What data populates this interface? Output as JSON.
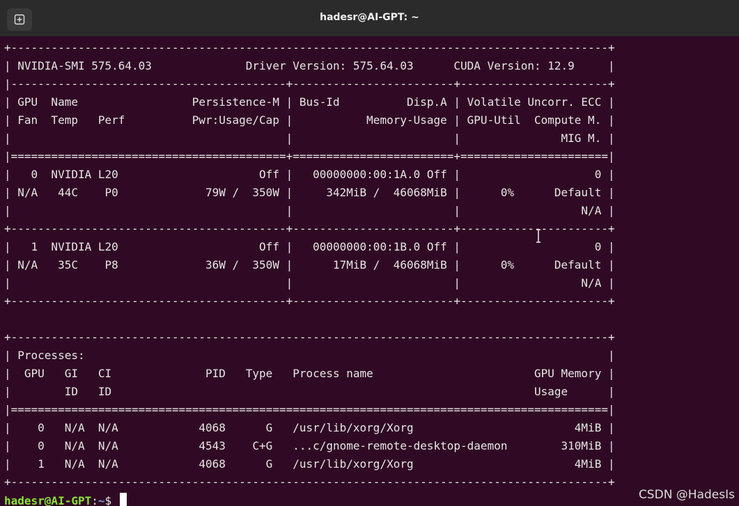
{
  "window": {
    "title": "hadesr@AI-GPT: ~",
    "new_tab_icon": "new-tab-icon"
  },
  "terminal": {
    "output": "+-----------------------------------------------------------------------------------------+\n| NVIDIA-SMI 575.64.03              Driver Version: 575.64.03      CUDA Version: 12.9     |\n|-----------------------------------------+------------------------+----------------------+\n| GPU  Name                 Persistence-M | Bus-Id          Disp.A | Volatile Uncorr. ECC |\n| Fan  Temp   Perf          Pwr:Usage/Cap |           Memory-Usage | GPU-Util  Compute M. |\n|                                         |                        |               MIG M. |\n|=========================================+========================+======================|\n|   0  NVIDIA L20                     Off |   00000000:00:1A.0 Off |                    0 |\n| N/A   44C    P0             79W /  350W |     342MiB /  46068MiB |      0%      Default |\n|                                         |                        |                  N/A |\n+-----------------------------------------+------------------------+----------------------+\n|   1  NVIDIA L20                     Off |   00000000:00:1B.0 Off |                    0 |\n| N/A   35C    P8             36W /  350W |      17MiB /  46068MiB |      0%      Default |\n|                                         |                        |                  N/A |\n+-----------------------------------------+------------------------+----------------------+\n\n+-----------------------------------------------------------------------------------------+\n| Processes:                                                                              |\n|  GPU   GI   CI              PID   Type   Process name                        GPU Memory |\n|        ID   ID                                                               Usage      |\n|=========================================================================================|\n|    0   N/A  N/A            4068      G   /usr/lib/xorg/Xorg                        4MiB |\n|    0   N/A  N/A            4543    C+G   ...c/gnome-remote-desktop-daemon        310MiB |\n|    1   N/A  N/A            4068      G   /usr/lib/xorg/Xorg                        4MiB |\n+-----------------------------------------------------------------------------------------+",
    "prompt_user": "hadesr@AI-GPT",
    "prompt_sep": ":",
    "prompt_path": "~",
    "prompt_symbol": "$ "
  },
  "watermark": "CSDN @HadesIs",
  "colors": {
    "terminal_bg": "#300a24",
    "titlebar_bg": "#2b2b2b",
    "prompt_user": "#8ae234",
    "prompt_path": "#729fcf"
  }
}
